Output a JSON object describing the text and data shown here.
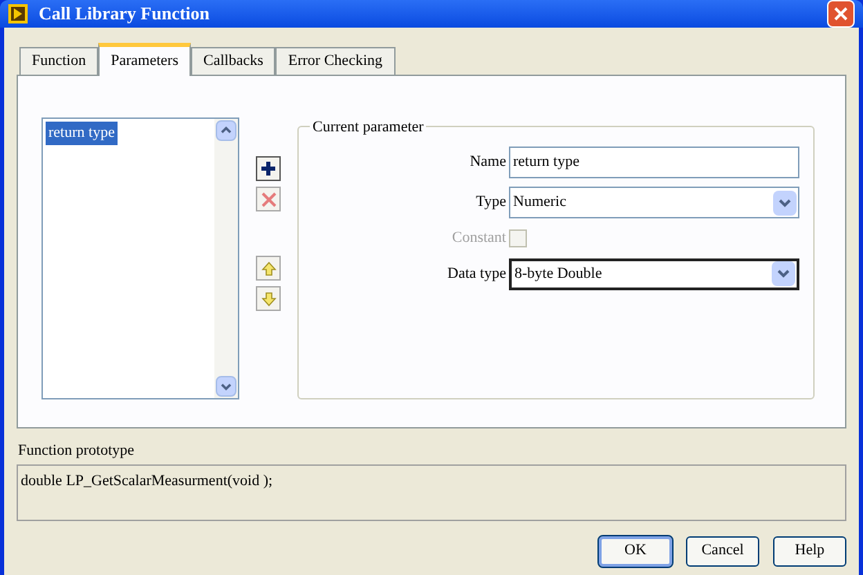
{
  "window": {
    "title": "Call Library Function"
  },
  "tabs": [
    {
      "label": "Function",
      "selected": false
    },
    {
      "label": "Parameters",
      "selected": true
    },
    {
      "label": "Callbacks",
      "selected": false
    },
    {
      "label": "Error Checking",
      "selected": false
    }
  ],
  "parameters": [
    {
      "label": "return type",
      "selected": true
    }
  ],
  "current_parameter": {
    "title": "Current parameter",
    "fields": [
      {
        "kind": "text",
        "label": "Name",
        "value": "return type"
      },
      {
        "kind": "dropdown",
        "label": "Type",
        "value": "Numeric",
        "focused": false
      },
      {
        "kind": "checkbox",
        "label": "Constant",
        "checked": false,
        "disabled": true
      },
      {
        "kind": "dropdown",
        "label": "Data type",
        "value": "8-byte Double",
        "focused": true
      }
    ]
  },
  "prototype": {
    "label": "Function prototype",
    "value": "double LP_GetScalarMeasurment(void );"
  },
  "buttons": [
    {
      "label": "OK",
      "default": true
    },
    {
      "label": "Cancel",
      "default": false
    },
    {
      "label": "Help",
      "default": false
    }
  ]
}
